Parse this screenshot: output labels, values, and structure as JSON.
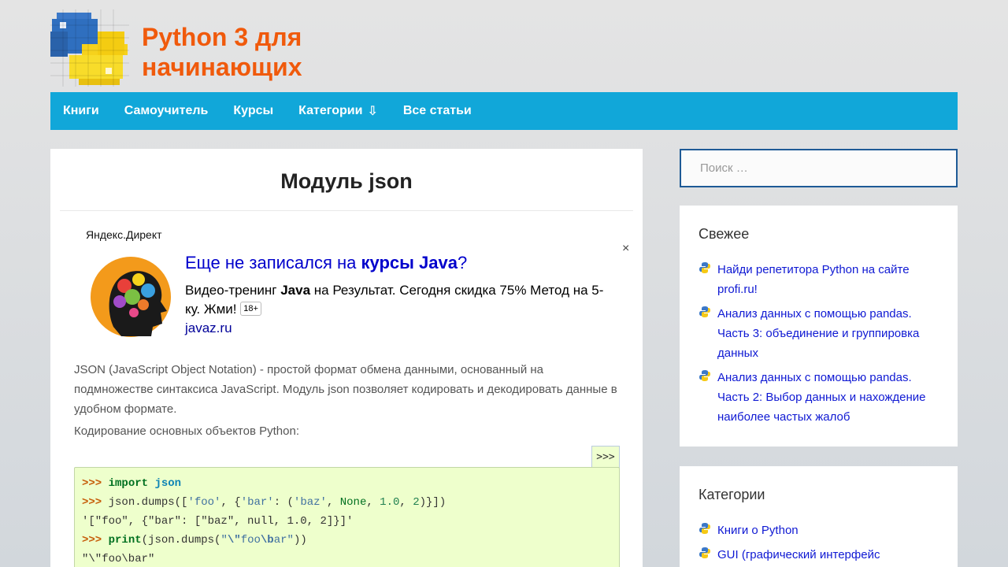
{
  "site": {
    "title_line1": "Python 3 для",
    "title_line2": "начинающих"
  },
  "nav": {
    "items": [
      "Книги",
      "Самоучитель",
      "Курсы",
      "Категории",
      "Все статьи"
    ],
    "categories_arrow": "⇩"
  },
  "post": {
    "title": "Модуль json",
    "intro": "JSON (JavaScript Object Notation) - простой формат обмена данными, основанный на подмножестве синтаксиса JavaScript. Модуль json позволяет кодировать и декодировать данные в удобном формате.",
    "lead": "Кодирование основных объектов Python:",
    "code_toggle": ">>>"
  },
  "ad": {
    "source": "Яндекс.Директ",
    "close": "×",
    "headline_pre": "Еще не записался на ",
    "headline_bold": "курсы Java",
    "headline_post": "?",
    "text_pre": "Видео-тренинг ",
    "text_bold": "Java",
    "text_post": " на Результат. Сегодня скидка 75% Метод на 5-ку. Жми!",
    "age": "18+",
    "domain": "javaz.ru"
  },
  "code": {
    "prompt": ">>>",
    "l1_kw": "import",
    "l1_mod": "json",
    "l2_a": "json.dumps([",
    "l2_foo": "'foo'",
    "l2_b": ", {",
    "l2_bar": "'bar'",
    "l2_c": ": (",
    "l2_baz": "'baz'",
    "l2_d": ", ",
    "l2_none": "None",
    "l2_e": ", ",
    "l2_f1": "1.0",
    "l2_g": ", ",
    "l2_i2": "2",
    "l2_h": ")}])",
    "l3": "'[\"foo\", {\"bar\": [\"baz\", null, 1.0, 2]}]'",
    "l4_print": "print",
    "l4_a": "(json.dumps(",
    "l4_s1": "\"",
    "l4_e1": "\\\"",
    "l4_s2": "foo",
    "l4_e2": "\\b",
    "l4_s3": "ar\"",
    "l4_b": "))",
    "l5": "\"\\\"foo\\bar\""
  },
  "sidebar": {
    "search_placeholder": "Поиск …",
    "recent_title": "Свежее",
    "recent": [
      "Найди репетитора Python на сайте profi.ru!",
      "Анализ данных с помощью pandas. Часть 3: объединение и группировка данных",
      "Анализ данных с помощью pandas. Часть 2: Выбор данных и нахождение наиболее частых жалоб"
    ],
    "cats_title": "Категории",
    "cats": [
      "Книги о Python",
      "GUI (графический интерфейс"
    ]
  },
  "colors": {
    "title": "#f05a0c",
    "nav": "#11a7d9",
    "link": "#0f19d3",
    "search_border": "#1e5a96"
  }
}
